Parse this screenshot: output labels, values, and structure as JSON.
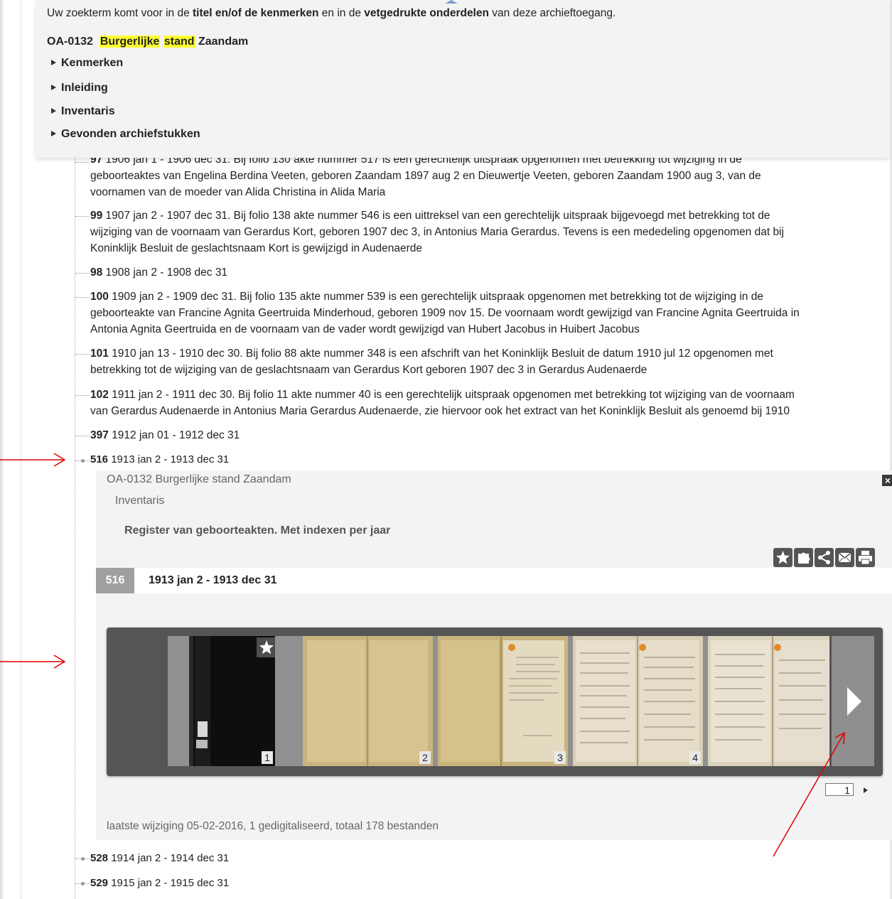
{
  "search_note": {
    "p1": "Uw zoekterm komt voor in de ",
    "b1": "titel en/of de kenmerken",
    "p2": " en in de ",
    "b2": "vetgedrukte onderdelen",
    "p3": " van deze archieftoegang."
  },
  "archive": {
    "code": "OA-0132",
    "hl1": "Burgerlijke",
    "hl2": "stand",
    "place": "Zaandam"
  },
  "sections": [
    "Kenmerken",
    "Inleiding",
    "Inventaris",
    "Gevonden archiefstukken"
  ],
  "items": [
    {
      "num": "97",
      "l1": " 1906 jan 1 - 1906 dec 31. Bij folio 130 akte nummer 517 is een gerechtelijk uitspraak opgenomen met betrekking tot wijziging in de",
      "l2": "geboorteaktes van Engelina Berdina Veeten, geboren Zaandam 1897 aug 2 en Dieuwertje Veeten, geboren Zaandam 1900 aug 3, van de",
      "l3": "voornamen van de moeder van Alida Christina in Alida Maria"
    },
    {
      "num": "99",
      "l1": " 1907 jan 2 - 1907 dec 31. Bij folio 138 akte nummer 546 is een uittreksel van een gerechtelijk uitspraak bijgevoegd met betrekking tot de",
      "l2": "wijziging van de voornaam van Gerardus Kort, geboren 1907 dec 3, in Antonius Maria Gerardus. Tevens is een mededeling opgenomen dat bij",
      "l3": "Koninklijk Besluit de geslachtsnaam Kort is gewijzigd in Audenaerde"
    },
    {
      "num": "98",
      "l1": " 1908 jan 2 - 1908 dec 31"
    },
    {
      "num": "100",
      "l1": " 1909 jan 2 - 1909 dec 31. Bij folio 135 akte nummer 539 is een gerechtelijk uitspraak opgenomen met betrekking tot de wijziging in de",
      "l2": "geboorteakte van Francine Agnita Geertruida Minderhoud, geboren 1909 nov 15. De voornaam wordt gewijzigd van Francine Agnita Geertruida in",
      "l3": "Antonia Agnita Geertruida en de voornaam van de vader wordt gewijzigd van Hubert Jacobus in Huibert Jacobus"
    },
    {
      "num": "101",
      "l1": " 1910 jan 13 - 1910 dec 30. Bij folio 88 akte nummer 348 is een afschrift van het Koninklijk Besluit de datum 1910 jul 12 opgenomen met",
      "l2": "betrekking tot de wijziging van de geslachtsnaam van Gerardus Kort geboren 1907 dec 3 in Gerardus Audenaerde"
    },
    {
      "num": "102",
      "l1": " 1911 jan 2 - 1911 dec 30. Bij folio 11 akte nummer 40 is een gerechtelijk uitspraak opgenomen met betrekking tot wijziging van de voornaam",
      "l2": "van Gerardus Audenaerde in Antonius Maria Gerardus Audenaerde, zie hiervoor ook het extract van het Koninklijk Besluit als genoemd bij 1910"
    },
    {
      "num": "397",
      "l1": " 1912 jan 01 - 1912 dec 31"
    },
    {
      "num": "516",
      "l1": " 1913 jan 2 - 1913 dec 31"
    }
  ],
  "detail": {
    "path": "OA-0132 Burgerlijke stand Zaandam",
    "sub": "Inventaris",
    "desc": "Register van geboorteakten. Met indexen per jaar",
    "close": "×",
    "inv_num": "516",
    "inv_date": "1913 jan 2 - 1913 dec 31",
    "thumb_nums": [
      "1",
      "2",
      "3",
      "4"
    ],
    "page": "1",
    "footer": "laatste wijziging 05-02-2016,  1 gedigitaliseerd, totaal 178 bestanden"
  },
  "after_items": [
    {
      "num": "528",
      "l1": " 1914 jan 2 - 1914 dec 31"
    },
    {
      "num": "529",
      "l1": " 1915 jan 2 - 1915 dec 31"
    }
  ],
  "colors": {
    "highlight": "#ffff33",
    "arrow": "#e00000",
    "viewer_bg": "#555555"
  },
  "icons": [
    "star-icon",
    "puzzle-icon",
    "share-icon",
    "mail-icon",
    "print-icon",
    "next-arrow-icon",
    "close-icon"
  ]
}
